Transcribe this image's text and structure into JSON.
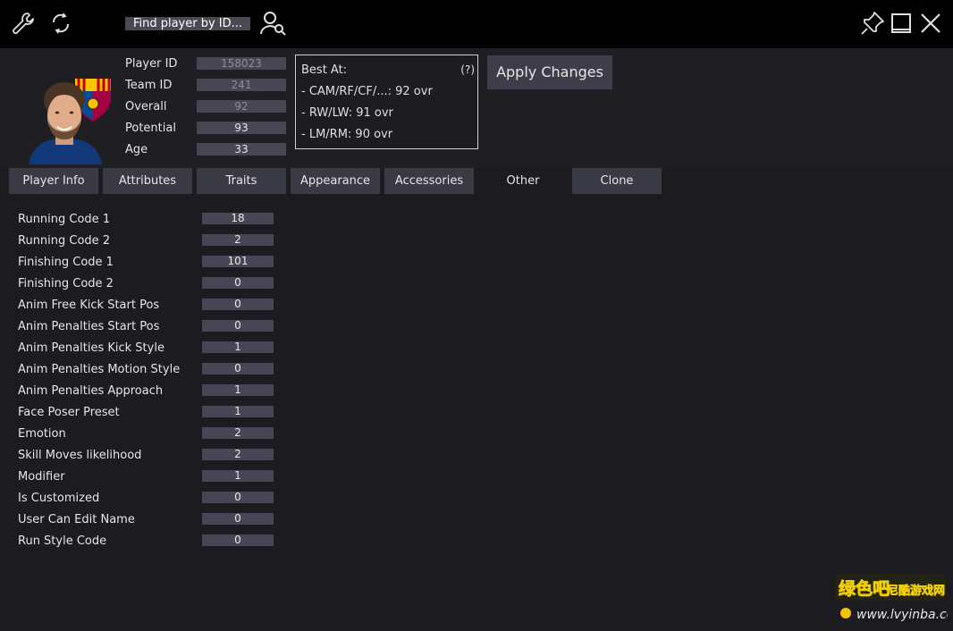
{
  "toolbar": {
    "settings_icon": "wrench-icon",
    "refresh_icon": "refresh-icon",
    "find_label": "Find player by ID...",
    "player_search_icon": "user-search-icon",
    "pin_icon": "pin-icon",
    "maximize_icon": "maximize-icon",
    "close_icon": "close-icon"
  },
  "player": {
    "fields": [
      {
        "label": "Player ID",
        "value": "158023"
      },
      {
        "label": "Team ID",
        "value": "241"
      },
      {
        "label": "Overall",
        "value": "92"
      },
      {
        "label": "Potential",
        "value": "93"
      },
      {
        "label": "Age",
        "value": "33"
      }
    ]
  },
  "best_at": {
    "title": "Best At:",
    "help": "(?)",
    "lines": [
      "- CAM/RF/CF/...: 92 ovr",
      "- RW/LW: 91 ovr",
      "- LM/RM: 90 ovr"
    ]
  },
  "apply_label": "Apply Changes",
  "tabs": [
    {
      "label": "Player Info"
    },
    {
      "label": "Attributes"
    },
    {
      "label": "Traits"
    },
    {
      "label": "Appearance"
    },
    {
      "label": "Accessories"
    },
    {
      "label": "Other",
      "active": true
    },
    {
      "label": "Clone"
    }
  ],
  "other": {
    "rows": [
      {
        "label": "Running Code 1",
        "value": "18"
      },
      {
        "label": "Running Code 2",
        "value": "2"
      },
      {
        "label": "Finishing Code 1",
        "value": "101"
      },
      {
        "label": "Finishing Code 2",
        "value": "0"
      },
      {
        "label": "Anim Free Kick Start Pos",
        "value": "0"
      },
      {
        "label": "Anim Penalties Start Pos",
        "value": "0"
      },
      {
        "label": "Anim Penalties Kick Style",
        "value": "1"
      },
      {
        "label": "Anim Penalties Motion Style",
        "value": "0"
      },
      {
        "label": "Anim Penalties Approach",
        "value": "1"
      },
      {
        "label": "Face Poser Preset",
        "value": "1"
      },
      {
        "label": "Emotion",
        "value": "2"
      },
      {
        "label": "Skill Moves likelihood",
        "value": "2"
      },
      {
        "label": "Modifier",
        "value": "1"
      },
      {
        "label": "Is Customized",
        "value": "0"
      },
      {
        "label": "User Can Edit Name",
        "value": "0"
      },
      {
        "label": "Run Style Code",
        "value": "0"
      }
    ]
  },
  "watermark": {
    "line1": "绿色吧",
    "line2": "尼酷游戏网",
    "url": "www.lvyinba.com"
  },
  "colors": {
    "background": "#1b1b20",
    "field": "#464654",
    "tab": "#3a3a45",
    "topbar": "#000000"
  }
}
